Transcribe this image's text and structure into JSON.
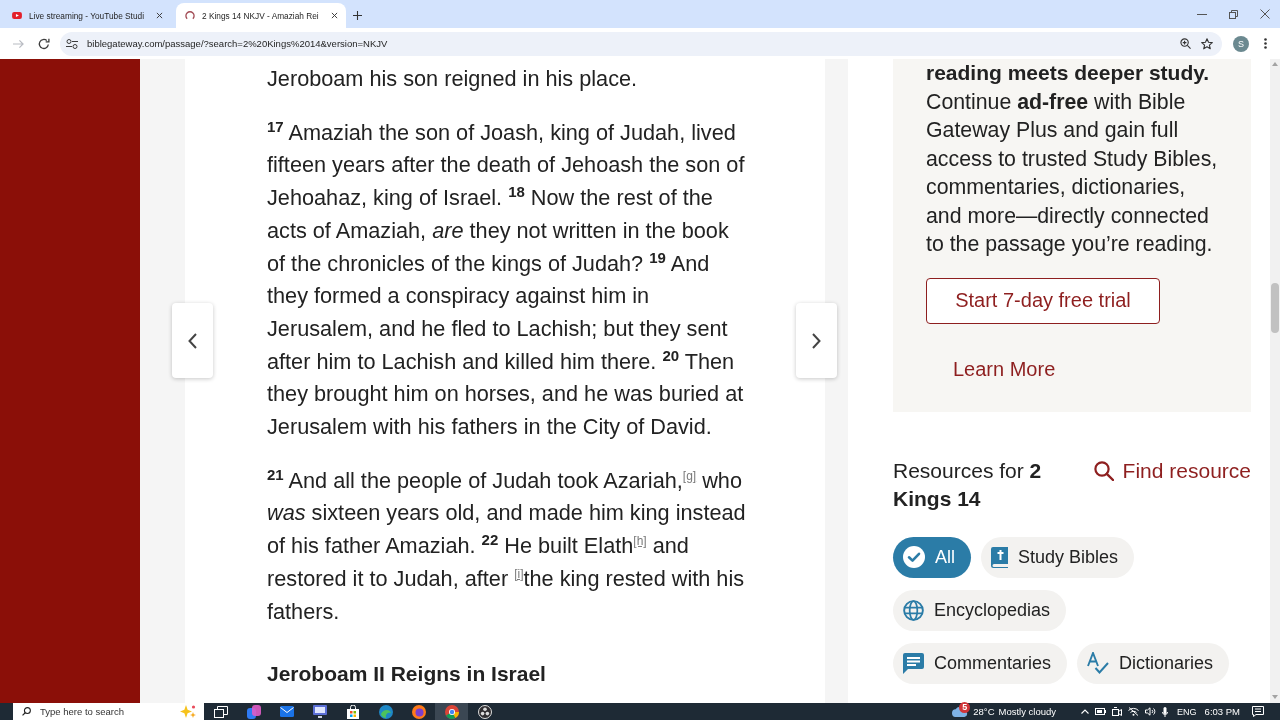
{
  "browser": {
    "tabs": [
      {
        "title": "Live streaming - YouTube Studi",
        "selected": false,
        "loading": false
      },
      {
        "title": "2 Kings 14 NKJV - Amaziah Rei",
        "selected": true,
        "loading": true
      }
    ],
    "forward_button": {
      "disabled": true
    },
    "url": "biblegateway.com/passage/?search=2%20Kings%2014&version=NKJV",
    "profile_initial": "S"
  },
  "passage": {
    "paragraphs": [
      {
        "verses": [
          {
            "text": "Jeroboam his son reigned in his place."
          }
        ]
      },
      {
        "verses": [
          {
            "number": "17",
            "text": "Amaziah the son of Joash, king of Judah, lived fifteen years after the death of Jehoash the son of Jehoahaz, king of Israel."
          },
          {
            "number": "18",
            "text": "Now the rest of the acts of Amaziah, *are* they not written in the book of the chronicles of the kings of Judah?"
          },
          {
            "number": "19",
            "text": "And they formed a conspiracy against him in Jerusalem, and he fled to Lachish; but they sent after him to Lachish and killed him there."
          },
          {
            "number": "20",
            "text": "Then they brought him on horses, and he was buried at Jerusalem with his fathers in the City of David."
          }
        ]
      },
      {
        "verses": [
          {
            "number": "21",
            "text": "And all the people of Judah took Azariah,$^{[g]}$ who *was* sixteen years old, and made him king instead of his father Amaziah."
          },
          {
            "number": "22",
            "text": "He built Elath$^{[h]}$ and restored it to Judah, after $^{[i]}$the king rested with his fathers."
          }
        ]
      }
    ],
    "heading": "Jeroboam II Reigns in Israel"
  },
  "promo": {
    "heading_end": "reading meets deeper study.",
    "body": "Continue **ad-free** with Bible Gateway Plus and gain full access to trusted Study Bibles, commentaries, dictionaries, and more—directly connected to the passage you’re reading.",
    "trial_button": "Start 7-day free trial",
    "learn_more": "Learn More"
  },
  "resources": {
    "title": "Resources for **2 Kings 14**",
    "find": "Find resource",
    "filters": [
      {
        "label": "All",
        "kind": "all",
        "selected": true
      },
      {
        "label": "Study Bibles",
        "kind": "bibles",
        "selected": false
      },
      {
        "label": "Encyclopedias",
        "kind": "encyclopedias",
        "selected": false
      },
      {
        "label": "Commentaries",
        "kind": "commentaries",
        "selected": false
      },
      {
        "label": "Dictionaries",
        "kind": "dictionaries",
        "selected": false
      }
    ]
  },
  "taskbar": {
    "search": {
      "placeholder": "Type here to search"
    },
    "apps": [
      {
        "kind": "windows",
        "selected": false
      },
      {
        "kind": "shapes",
        "selected": false
      },
      {
        "kind": "envelope",
        "selected": false
      },
      {
        "kind": "monitor",
        "selected": false
      },
      {
        "kind": "bag",
        "selected": false
      },
      {
        "kind": "wave",
        "selected": false
      },
      {
        "kind": "ring",
        "selected": false
      },
      {
        "kind": "segments",
        "selected": true
      },
      {
        "kind": "dots",
        "selected": false
      }
    ],
    "weather": {
      "badge": "5",
      "temperature": "28°C",
      "condition": "Mostly cloudy"
    },
    "language": "ENG",
    "time": "6:03 PM"
  }
}
